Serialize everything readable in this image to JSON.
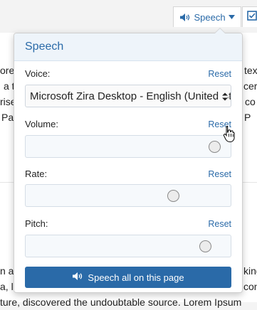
{
  "toolbar": {
    "speech_label": "Speech",
    "speaker_icon": "speaker-icon",
    "caret_icon": "caret-down-icon",
    "check_icon": "checkbox-icon"
  },
  "background": {
    "lines": [
      "orem",
      "a t",
      "rised",
      "Pag",
      "tex",
      "cer",
      "co",
      "P",
      "n a",
      "a, l",
      "ture, discovered the undoubtable source. Lorem Ipsum",
      "king",
      "con"
    ]
  },
  "popup": {
    "title": "Speech",
    "voice": {
      "label": "Voice:",
      "reset": "Reset",
      "selected": "Microsoft Zira Desktop - English (United States)"
    },
    "volume": {
      "label": "Volume:",
      "reset": "Reset",
      "level": 0.96
    },
    "rate": {
      "label": "Rate:",
      "reset": "Reset",
      "level": 0.74
    },
    "pitch": {
      "label": "Pitch:",
      "reset": "Reset",
      "level": 0.91
    },
    "action": {
      "label": "Speech all on this page"
    }
  },
  "colors": {
    "accent": "#2a6aa8",
    "header_bg": "#eef4fa"
  }
}
